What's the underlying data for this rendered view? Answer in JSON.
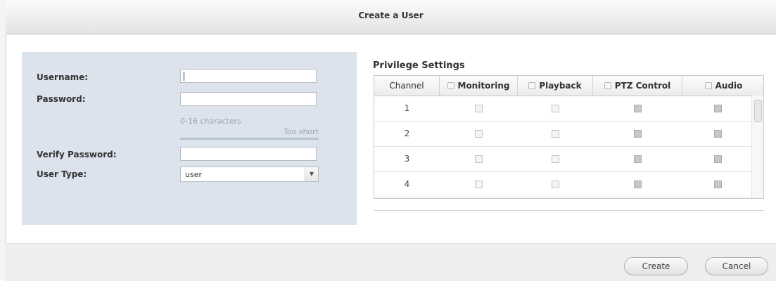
{
  "dialog": {
    "title": "Create a User"
  },
  "form": {
    "username_label": "Username:",
    "username_value": "",
    "password_label": "Password:",
    "password_value": "",
    "password_hint": "0-16 characters",
    "password_strength": "Too short",
    "verify_label": "Verify Password:",
    "verify_value": "",
    "user_type_label": "User Type:",
    "user_type_value": "user"
  },
  "privileges": {
    "title": "Privilege Settings",
    "columns": [
      "Channel",
      "Monitoring",
      "Playback",
      "PTZ Control",
      "Audio"
    ],
    "rows": [
      {
        "channel": "1"
      },
      {
        "channel": "2"
      },
      {
        "channel": "3"
      },
      {
        "channel": "4"
      }
    ]
  },
  "buttons": {
    "create": "Create",
    "cancel": "Cancel"
  }
}
